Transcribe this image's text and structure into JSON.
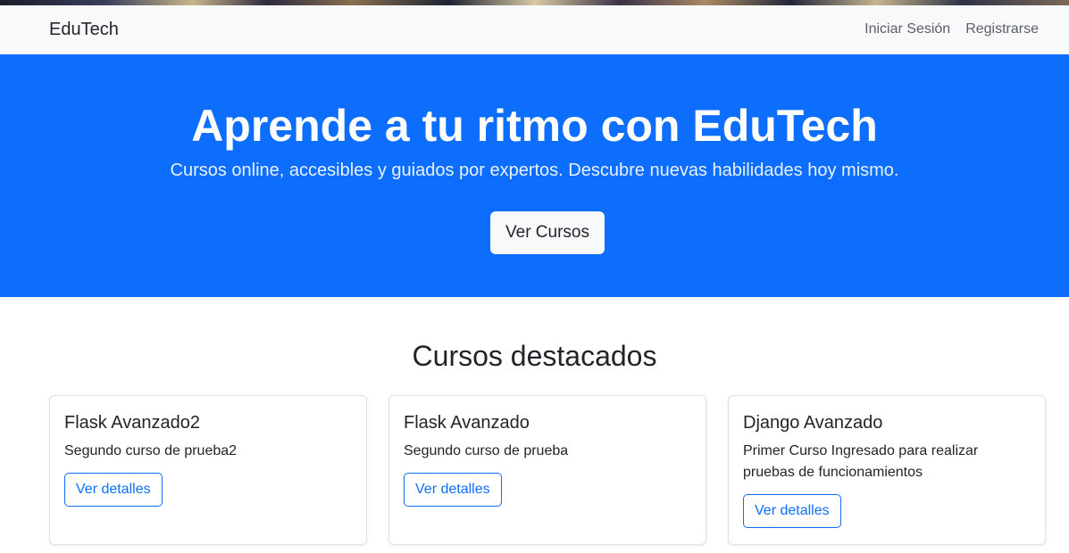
{
  "navbar": {
    "brand": "EduTech",
    "links": [
      "Iniciar Sesión",
      "Registrarse"
    ]
  },
  "hero": {
    "title": "Aprende a tu ritmo con EduTech",
    "subtitle": "Cursos online, accesibles y guiados por expertos. Descubre nuevas habilidades hoy mismo.",
    "button": "Ver Cursos"
  },
  "courses": {
    "heading": "Cursos destacados",
    "items": [
      {
        "title": "Flask Avanzado2",
        "description": "Segundo curso de prueba2",
        "button": "Ver detalles"
      },
      {
        "title": "Flask Avanzado",
        "description": "Segundo curso de prueba",
        "button": "Ver detalles"
      },
      {
        "title": "Django Avanzado",
        "description": "Primer Curso Ingresado para realizar pruebas de funcionamientos",
        "button": "Ver detalles"
      }
    ]
  },
  "colors": {
    "primary": "#0d6efd",
    "navbar_bg": "#f8f9fa"
  }
}
